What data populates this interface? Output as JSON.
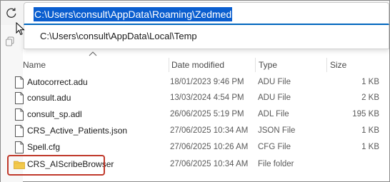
{
  "address_bar": {
    "path": "C:\\Users\\consult\\AppData\\Roaming\\Zedmed",
    "suggestion": "C:\\Users\\consult\\AppData\\Local\\Temp"
  },
  "columns": {
    "name": "Name",
    "date": "Date modified",
    "type": "Type",
    "size": "Size"
  },
  "files": [
    {
      "name": "Autocorrect.adu",
      "date": "18/01/2023 9:46 PM",
      "type": "ADU File",
      "size": "1 KB",
      "icon": "file-icon"
    },
    {
      "name": "consult.adu",
      "date": "13/03/2024 4:54 PM",
      "type": "ADU File",
      "size": "2 KB",
      "icon": "file-icon"
    },
    {
      "name": "consult_sp.adl",
      "date": "26/06/2025 5:19 PM",
      "type": "ADL File",
      "size": "195 KB",
      "icon": "file-icon"
    },
    {
      "name": "CRS_Active_Patients.json",
      "date": "27/06/2025 10:34 AM",
      "type": "JSON File",
      "size": "1 KB",
      "icon": "file-icon"
    },
    {
      "name": "Spell.cfg",
      "date": "27/06/2025 10:26 AM",
      "type": "CFG File",
      "size": "1 KB",
      "icon": "file-icon"
    },
    {
      "name": "CRS_AIScribeBrowser",
      "date": "27/06/2025 10:34 AM",
      "type": "File folder",
      "size": "",
      "icon": "folder-icon"
    }
  ],
  "colors": {
    "selection": "#0a5ecf",
    "highlight_border": "#c0392b",
    "folder": "#f2c94c"
  }
}
